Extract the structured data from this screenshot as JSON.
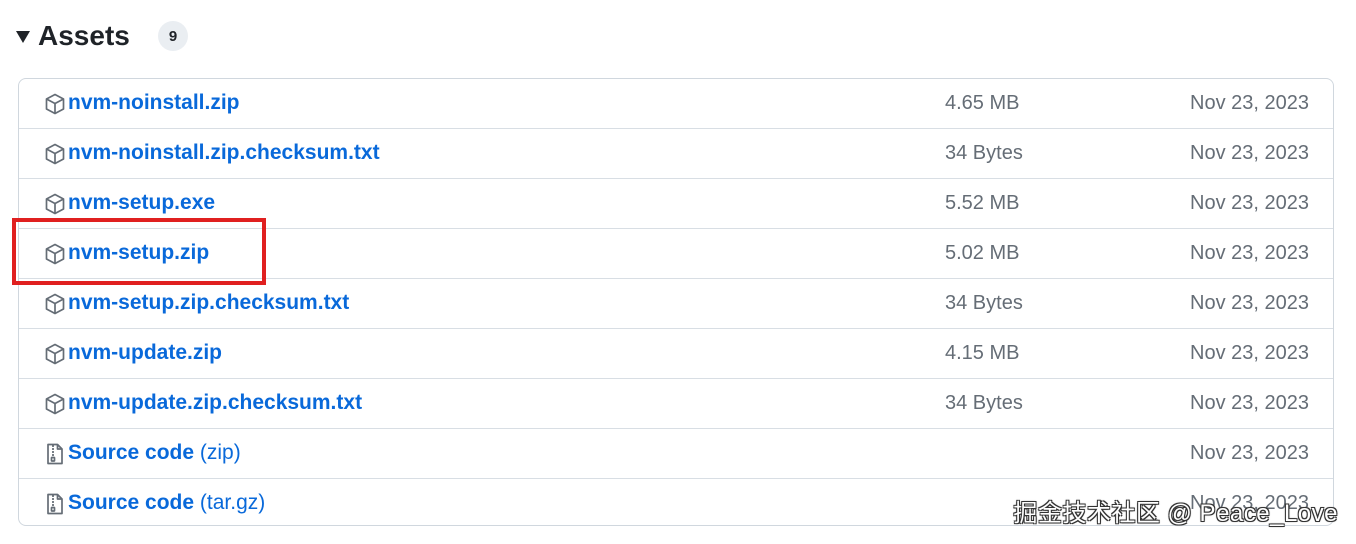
{
  "header": {
    "title": "Assets",
    "count": "9"
  },
  "assets": [
    {
      "name": "nvm-noinstall.zip",
      "suffix": "",
      "size": "4.65 MB",
      "date": "Nov 23, 2023",
      "icon": "package-icon"
    },
    {
      "name": "nvm-noinstall.zip.checksum.txt",
      "suffix": "",
      "size": "34 Bytes",
      "date": "Nov 23, 2023",
      "icon": "package-icon"
    },
    {
      "name": "nvm-setup.exe",
      "suffix": "",
      "size": "5.52 MB",
      "date": "Nov 23, 2023",
      "icon": "package-icon"
    },
    {
      "name": "nvm-setup.zip",
      "suffix": "",
      "size": "5.02 MB",
      "date": "Nov 23, 2023",
      "icon": "package-icon"
    },
    {
      "name": "nvm-setup.zip.checksum.txt",
      "suffix": "",
      "size": "34 Bytes",
      "date": "Nov 23, 2023",
      "icon": "package-icon"
    },
    {
      "name": "nvm-update.zip",
      "suffix": "",
      "size": "4.15 MB",
      "date": "Nov 23, 2023",
      "icon": "package-icon"
    },
    {
      "name": "nvm-update.zip.checksum.txt",
      "suffix": "",
      "size": "34 Bytes",
      "date": "Nov 23, 2023",
      "icon": "package-icon"
    },
    {
      "name": "Source code",
      "suffix": "(zip)",
      "size": "",
      "date": "Nov 23, 2023",
      "icon": "file-zip-icon"
    },
    {
      "name": "Source code",
      "suffix": "(tar.gz)",
      "size": "",
      "date": "Nov 23, 2023",
      "icon": "file-zip-icon"
    }
  ],
  "annotation": {
    "highlight_color": "#e02020"
  },
  "watermark": "掘金技术社区 @ Peace_Love",
  "colors": {
    "link": "#0969da",
    "muted": "#656d76",
    "border": "#d0d7de"
  }
}
